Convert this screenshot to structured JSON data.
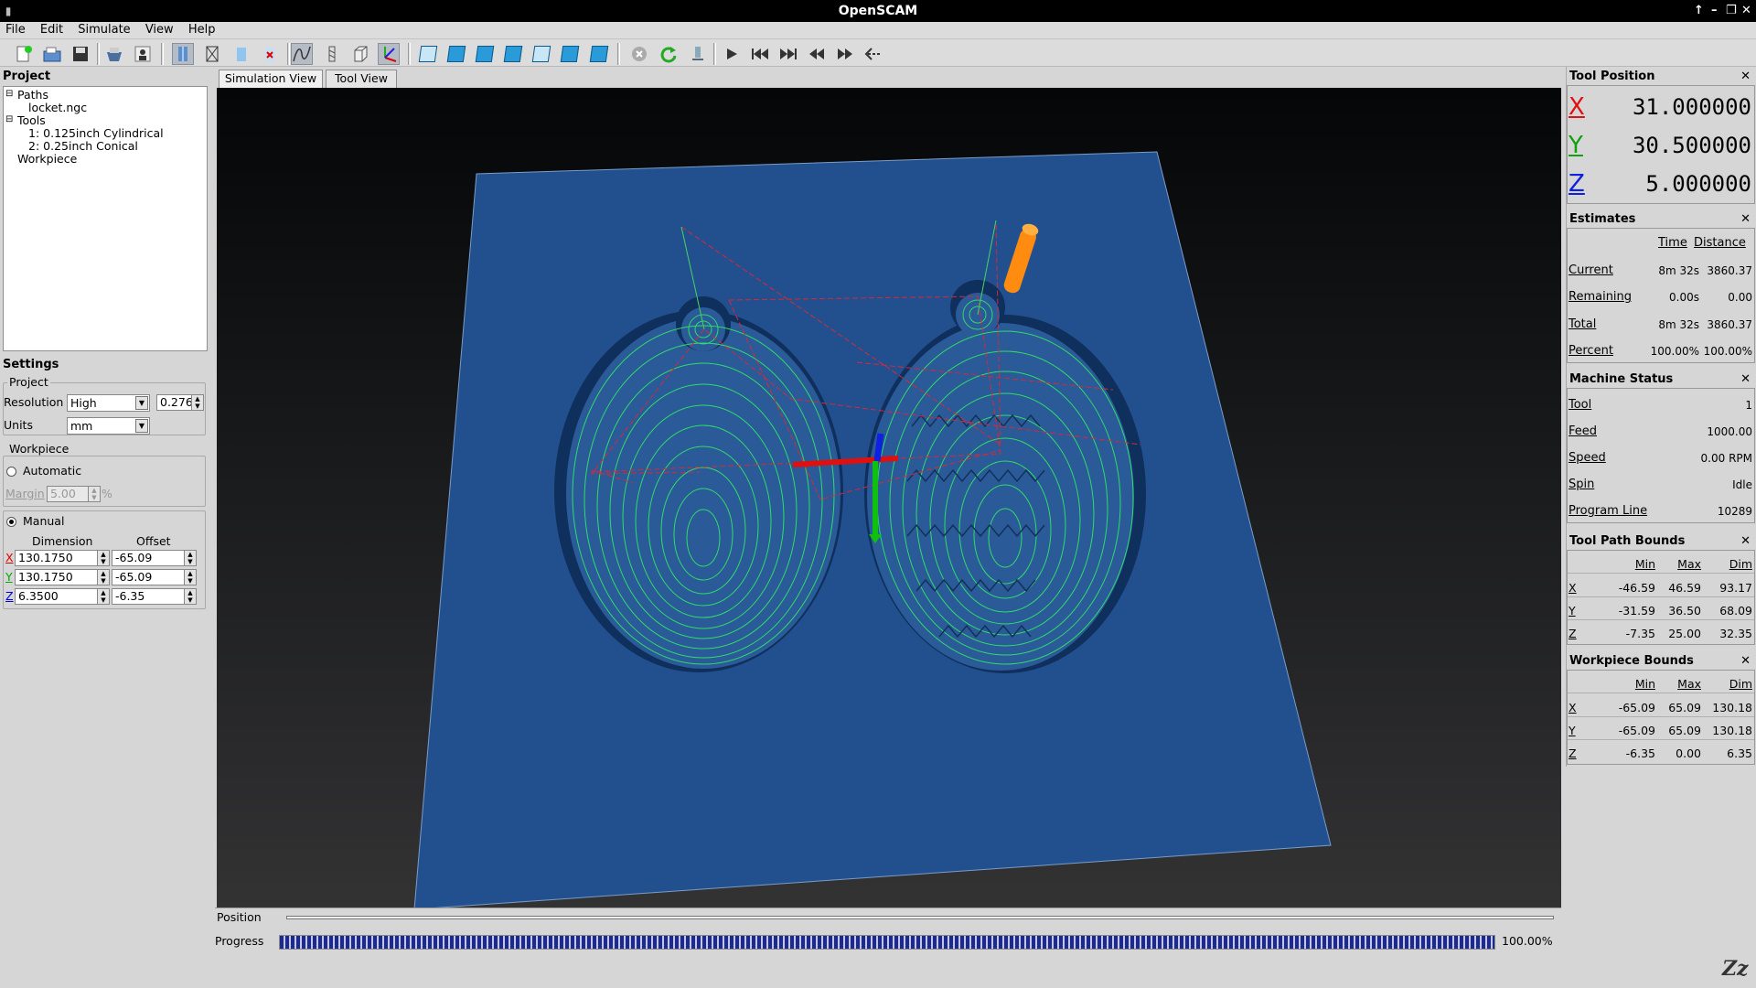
{
  "window": {
    "title": "OpenSCAM"
  },
  "menu": [
    "File",
    "Edit",
    "Simulate",
    "View",
    "Help"
  ],
  "toolbar": {
    "icons": [
      "new-file",
      "open-file",
      "save-file",
      "export",
      "settings-person",
      "view-path",
      "view-wire",
      "view-surface",
      "view-delete",
      "show-path",
      "show-tool",
      "show-bounds",
      "show-axes",
      "view-iso",
      "view-front",
      "view-top",
      "view-right",
      "view-left",
      "view-back",
      "view-bottom",
      "stop",
      "reload",
      "reset",
      "play",
      "skip-begin",
      "skip-end",
      "step-back",
      "step-forward",
      "direction"
    ]
  },
  "project": {
    "title": "Project",
    "tree": {
      "paths": "Paths",
      "file": "locket.ngc",
      "tools": "Tools",
      "tool1": "1: 0.125inch Cylindrical",
      "tool2": "2: 0.25inch Conical",
      "workpiece": "Workpiece"
    }
  },
  "settings": {
    "title": "Settings",
    "project_group": "Project",
    "resolution_label": "Resolution",
    "resolution_value": "High",
    "resolution_num": "0.276",
    "units_label": "Units",
    "units_value": "mm",
    "workpiece_group": "Workpiece",
    "automatic": "Automatic",
    "margin_label": "Margin",
    "margin_value": "5.00",
    "margin_unit": "%",
    "manual": "Manual",
    "dimension_header": "Dimension",
    "offset_header": "Offset",
    "axes": [
      "X",
      "Y",
      "Z"
    ],
    "dimensions": [
      "130.1750",
      "130.1750",
      "6.3500"
    ],
    "offsets": [
      "-65.09",
      "-65.09",
      "-6.35"
    ]
  },
  "tabs": {
    "simulation": "Simulation View",
    "tool": "Tool View"
  },
  "bottom": {
    "position": "Position",
    "progress": "Progress",
    "progress_value": "100.00%",
    "progress_fraction": 1.0
  },
  "tool_position": {
    "title": "Tool Position",
    "x_label": "X",
    "y_label": "Y",
    "z_label": "Z",
    "x": "31.000000",
    "y": "30.500000",
    "z": "5.000000"
  },
  "estimates": {
    "title": "Estimates",
    "col_time": "Time",
    "col_distance": "Distance",
    "rows": [
      {
        "label": "Current",
        "time": "8m 32s",
        "distance": "3860.37"
      },
      {
        "label": "Remaining",
        "time": "0.00s",
        "distance": "0.00"
      },
      {
        "label": "Total",
        "time": "8m 32s",
        "distance": "3860.37"
      },
      {
        "label": "Percent",
        "time": "100.00%",
        "distance": "100.00%"
      }
    ]
  },
  "machine_status": {
    "title": "Machine Status",
    "rows": [
      {
        "label": "Tool",
        "value": "1"
      },
      {
        "label": "Feed",
        "value": "1000.00"
      },
      {
        "label": "Speed",
        "value": "0.00 RPM"
      },
      {
        "label": "Spin",
        "value": "Idle"
      },
      {
        "label": "Program Line",
        "value": "10289"
      }
    ]
  },
  "tool_path_bounds": {
    "title": "Tool Path Bounds",
    "headers": [
      "Min",
      "Max",
      "Dim"
    ],
    "rows": [
      {
        "axis": "X",
        "min": "-46.59",
        "max": "46.59",
        "dim": "93.17"
      },
      {
        "axis": "Y",
        "min": "-31.59",
        "max": "36.50",
        "dim": "68.09"
      },
      {
        "axis": "Z",
        "min": "-7.35",
        "max": "25.00",
        "dim": "32.35"
      }
    ]
  },
  "workpiece_bounds": {
    "title": "Workpiece Bounds",
    "headers": [
      "Min",
      "Max",
      "Dim"
    ],
    "rows": [
      {
        "axis": "X",
        "min": "-65.09",
        "max": "65.09",
        "dim": "130.18"
      },
      {
        "axis": "Y",
        "min": "-65.09",
        "max": "65.09",
        "dim": "130.18"
      },
      {
        "axis": "Z",
        "min": "-6.35",
        "max": "0.00",
        "dim": "6.35"
      }
    ]
  },
  "colors": {
    "workpiece": "#22508f",
    "toolpath_green": "#2fdc6a",
    "toolpath_red": "#d8283a",
    "tool": "#ff8c10",
    "x_axis": "#e01010",
    "y_axis": "#10c010",
    "z_axis": "#1020e0",
    "progress": "#1e2a8a"
  }
}
